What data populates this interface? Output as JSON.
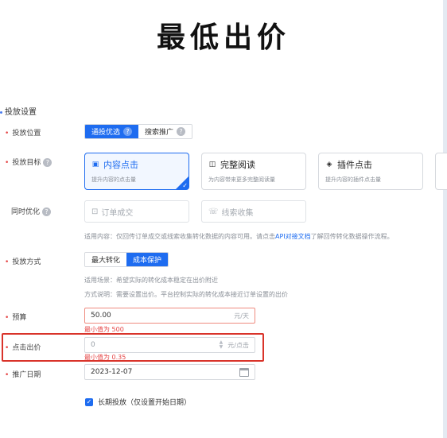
{
  "title": "最低出价",
  "section": {
    "label": "投放设置"
  },
  "placement": {
    "label": "投放位置",
    "options": [
      "通投优选",
      "搜索推广"
    ],
    "selected": "通投优选"
  },
  "goal": {
    "label": "投放目标",
    "cards": [
      {
        "title": "内容点击",
        "desc": "提升内容的点击量",
        "icon": "cursor-icon",
        "selected": true
      },
      {
        "title": "完整阅读",
        "desc": "为内容带来更多完整阅读量",
        "icon": "book-icon",
        "selected": false
      },
      {
        "title": "插件点击",
        "desc": "提升内容的插件点击量",
        "icon": "plugin-icon",
        "selected": false
      }
    ]
  },
  "sync_optimize": {
    "label": "同时优化",
    "options": [
      {
        "title": "订单成交",
        "icon": "cart-icon"
      },
      {
        "title": "线索收集",
        "icon": "phone-icon"
      }
    ],
    "note_prefix": "适用内容：仅回传订单成交或线索收集转化数据的内容可用。请点击",
    "note_link": "API对接文档",
    "note_suffix": "了解回传转化数据操作流程。"
  },
  "method": {
    "label": "投放方式",
    "options": [
      "最大转化",
      "成本保护"
    ],
    "selected": "成本保护",
    "note_scene": "适用场景：希望实际的转化成本稳定在出价附近",
    "note_method": "方式说明：需要设置出价。平台控制实际的转化成本接近订单设置的出价"
  },
  "budget": {
    "label": "预算",
    "value": "50.00",
    "suffix": "元/天",
    "error": "最小值为 500"
  },
  "bid": {
    "label": "点击出价",
    "value": "0",
    "suffix": "元/点击",
    "error": "最小值为 0.35"
  },
  "date": {
    "label": "推广日期",
    "value": "2023-12-07"
  },
  "long_term": {
    "label": "长期投放（仅设置开始日期）",
    "checked": true
  },
  "colors": {
    "accent": "#1e6cf0",
    "error": "#e54545",
    "highlight": "#d9332a"
  }
}
